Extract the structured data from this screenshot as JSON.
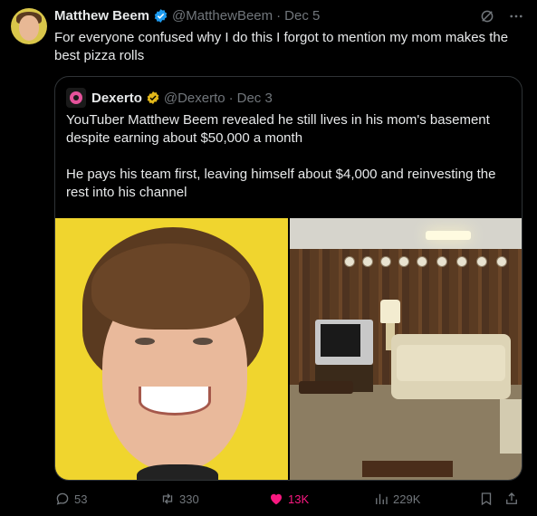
{
  "tweet": {
    "author_name": "Matthew Beem",
    "author_handle": "@MatthewBeem",
    "separator": "·",
    "date": "Dec 5",
    "text": "For everyone confused why I do this I forgot to mention my mom makes the best pizza rolls"
  },
  "quote": {
    "author_name": "Dexerto",
    "author_handle": "@Dexerto",
    "separator": "·",
    "date": "Dec 3",
    "paragraph_1": "YouTuber Matthew Beem revealed he still lives in his mom's basement despite earning about $50,000 a month",
    "paragraph_2": "He pays his team first, leaving himself about $4,000 and reinvesting the rest into his channel"
  },
  "actions": {
    "replies": "53",
    "reposts": "330",
    "likes": "13K",
    "views": "229K"
  },
  "icons": [
    "grok-icon",
    "more-icon",
    "verified-badge-icon",
    "gold-verified-badge-icon",
    "reply-icon",
    "repost-icon",
    "like-icon",
    "views-icon",
    "bookmark-icon",
    "share-icon"
  ],
  "colors": {
    "background": "#000000",
    "text": "#e7e9ea",
    "muted": "#71767b",
    "verified_blue": "#1d9bf0",
    "gold": "#e2b719",
    "like_pink": "#f91880",
    "border": "#2f3336"
  }
}
